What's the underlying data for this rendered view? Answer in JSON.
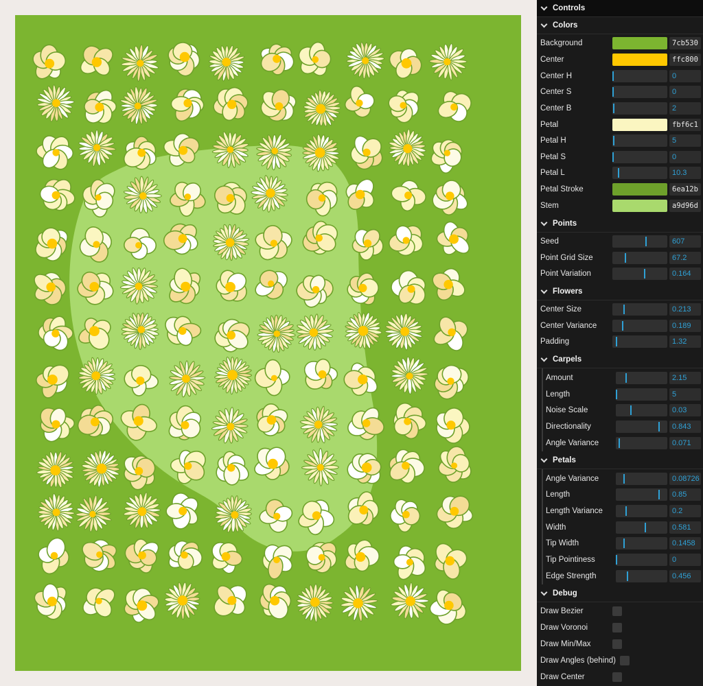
{
  "colors": {
    "background": "#7cb530",
    "meadow": "#a9d96d",
    "center": "#ffc800",
    "petal": "#fbf6c1",
    "petal_stroke": "#6ea12b",
    "stem": "#a9d96d",
    "panel_bg": "#1a1a1a",
    "accent": "#2fa1d6"
  },
  "panel": {
    "title": "Controls",
    "colors": {
      "title": "Colors",
      "background": {
        "label": "Background",
        "value": "7cb530",
        "color": "#7cb530"
      },
      "center": {
        "label": "Center",
        "value": "ffc800",
        "color": "#ffc800"
      },
      "center_h": {
        "label": "Center H",
        "value": "0"
      },
      "center_s": {
        "label": "Center S",
        "value": "0"
      },
      "center_b": {
        "label": "Center B",
        "value": "2"
      },
      "petal": {
        "label": "Petal",
        "value": "fbf6c1",
        "color": "#fbf6c1"
      },
      "petal_h": {
        "label": "Petal H",
        "value": "5"
      },
      "petal_s": {
        "label": "Petal S",
        "value": "0"
      },
      "petal_l": {
        "label": "Petal L",
        "value": "10.3"
      },
      "petal_stroke": {
        "label": "Petal Stroke",
        "value": "6ea12b",
        "color": "#6ea12b"
      },
      "stem": {
        "label": "Stem",
        "value": "a9d96d",
        "color": "#a9d96d"
      }
    },
    "points": {
      "title": "Points",
      "seed": {
        "label": "Seed",
        "value": "607"
      },
      "grid_size": {
        "label": "Point Grid Size",
        "value": "67.2"
      },
      "variation": {
        "label": "Point Variation",
        "value": "0.164"
      }
    },
    "flowers": {
      "title": "Flowers",
      "center_size": {
        "label": "Center Size",
        "value": "0.213"
      },
      "center_variance": {
        "label": "Center Variance",
        "value": "0.189"
      },
      "padding": {
        "label": "Padding",
        "value": "1.32"
      }
    },
    "carpels": {
      "title": "Carpels",
      "amount": {
        "label": "Amount",
        "value": "2.15"
      },
      "length": {
        "label": "Length",
        "value": "5"
      },
      "noise_scale": {
        "label": "Noise Scale",
        "value": "0.03"
      },
      "directionality": {
        "label": "Directionality",
        "value": "0.843"
      },
      "angle_variance": {
        "label": "Angle Variance",
        "value": "0.071"
      }
    },
    "petals": {
      "title": "Petals",
      "angle_variance": {
        "label": "Angle Variance",
        "value": "0.08726"
      },
      "length": {
        "label": "Length",
        "value": "0.85"
      },
      "length_variance": {
        "label": "Length Variance",
        "value": "0.2"
      },
      "width": {
        "label": "Width",
        "value": "0.581"
      },
      "tip_width": {
        "label": "Tip Width",
        "value": "0.1458"
      },
      "tip_pointiness": {
        "label": "Tip Pointiness",
        "value": "0"
      },
      "edge_strength": {
        "label": "Edge Strength",
        "value": "0.456"
      }
    },
    "debug": {
      "title": "Debug",
      "draw_bezier": {
        "label": "Draw Bezier",
        "checked": false
      },
      "draw_voronoi": {
        "label": "Draw Voronoi",
        "checked": false
      },
      "draw_minmax": {
        "label": "Draw Min/Max",
        "checked": false
      },
      "draw_angles": {
        "label": "Draw Angles (behind)",
        "checked": false
      },
      "draw_center": {
        "label": "Draw Center",
        "checked": false
      }
    }
  }
}
